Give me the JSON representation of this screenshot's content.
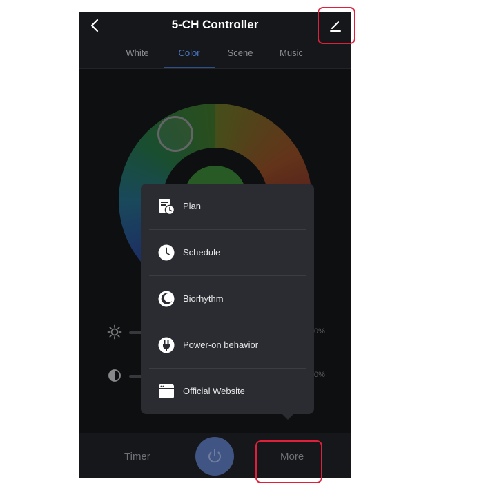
{
  "header": {
    "title": "5-CH Controller",
    "back_icon": "chevron-left-icon",
    "edit_icon": "pencil-icon"
  },
  "tabs": [
    {
      "label": "White",
      "active": false
    },
    {
      "label": "Color",
      "active": true
    },
    {
      "label": "Scene",
      "active": false
    },
    {
      "label": "Music",
      "active": false
    }
  ],
  "color_wheel": {
    "selected_color": "#3d8a3a"
  },
  "sliders": [
    {
      "icon": "brightness-icon",
      "value": "0%"
    },
    {
      "icon": "contrast-icon",
      "value": "0%"
    }
  ],
  "more_menu": {
    "items": [
      {
        "label": "Plan",
        "icon": "plan-icon"
      },
      {
        "label": "Schedule",
        "icon": "clock-icon"
      },
      {
        "label": "Biorhythm",
        "icon": "biorhythm-icon"
      },
      {
        "label": "Power-on behavior",
        "icon": "plug-icon"
      },
      {
        "label": "Official Website",
        "icon": "browser-window-icon"
      }
    ]
  },
  "bottom_bar": {
    "timer_label": "Timer",
    "more_label": "More",
    "power_icon": "power-icon"
  },
  "colors": {
    "background": "#16171b",
    "accent": "#4a7bc8",
    "popup": "#2b2c31",
    "highlight": "#e0203a"
  }
}
